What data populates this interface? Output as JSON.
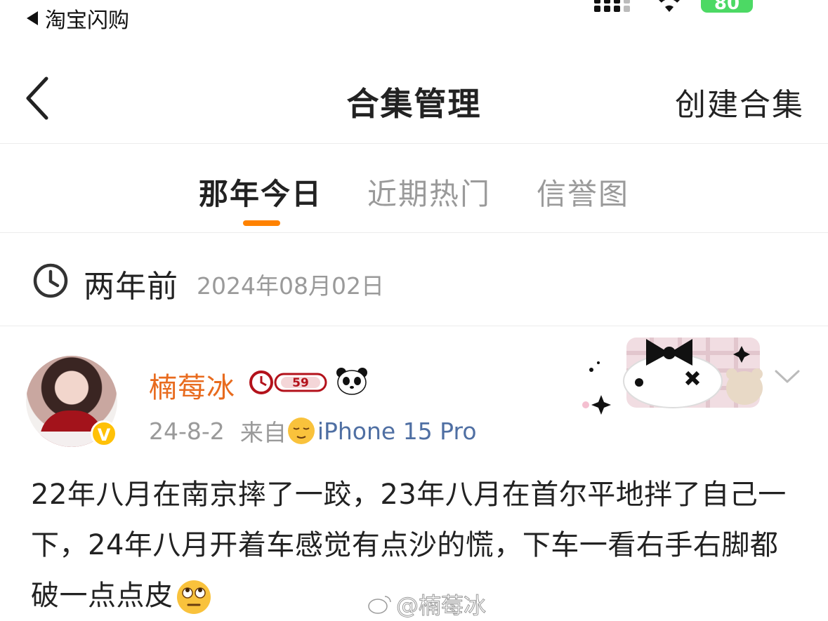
{
  "status_bar": {
    "back_app_label": "淘宝闪购",
    "battery_level": "80"
  },
  "nav": {
    "title": "合集管理",
    "create_label": "创建合集"
  },
  "tabs": {
    "items": [
      {
        "label": "那年今日",
        "active": true
      },
      {
        "label": "近期热门",
        "active": false
      },
      {
        "label": "信誉图",
        "active": false
      }
    ],
    "accent_color": "#ff8200"
  },
  "date_header": {
    "relative": "两年前",
    "date": "2024年08月02日"
  },
  "post": {
    "username": "楠莓冰",
    "username_color": "#e86b1e",
    "level": "59",
    "verified_badge": "V",
    "time": "24-8-2",
    "source_prefix": "来自",
    "device": "iPhone 15 Pro",
    "content": "22年八月在南京摔了一跤，23年八月在首尔平地拌了自己一下，24年八月开着车感觉有点沙的慌，下车一看右手右脚都破一点点皮",
    "watermark": "@楠莓冰"
  }
}
